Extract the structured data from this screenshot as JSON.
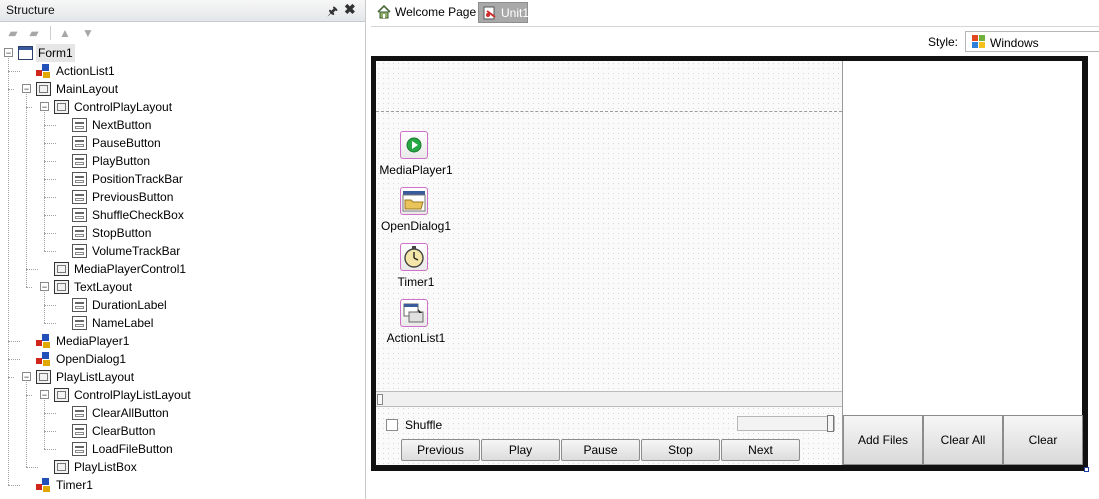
{
  "structure": {
    "title": "Structure",
    "pin_glyph": "🖈",
    "close_glyph": "✖",
    "toolbar": [
      {
        "icon": "folder-add-icon",
        "glyph": "▰"
      },
      {
        "icon": "folder-remove-icon",
        "glyph": "▰"
      },
      {
        "icon": "arrow-up-icon",
        "glyph": "▲"
      },
      {
        "icon": "arrow-down-icon",
        "glyph": "▼"
      }
    ],
    "tree": [
      {
        "label": "Form1",
        "icon": "form",
        "level": 0,
        "expander": "−",
        "selected": true
      },
      {
        "label": "ActionList1",
        "icon": "comp",
        "level": 1
      },
      {
        "label": "MainLayout",
        "icon": "layout",
        "level": 1,
        "expander": "−"
      },
      {
        "label": "ControlPlayLayout",
        "icon": "layout",
        "level": 2,
        "expander": "−"
      },
      {
        "label": "NextButton",
        "icon": "ctrl",
        "level": 3
      },
      {
        "label": "PauseButton",
        "icon": "ctrl",
        "level": 3
      },
      {
        "label": "PlayButton",
        "icon": "ctrl",
        "level": 3
      },
      {
        "label": "PositionTrackBar",
        "icon": "ctrl",
        "level": 3
      },
      {
        "label": "PreviousButton",
        "icon": "ctrl",
        "level": 3
      },
      {
        "label": "ShuffleCheckBox",
        "icon": "ctrl",
        "level": 3
      },
      {
        "label": "StopButton",
        "icon": "ctrl",
        "level": 3
      },
      {
        "label": "VolumeTrackBar",
        "icon": "ctrl",
        "level": 3
      },
      {
        "label": "MediaPlayerControl1",
        "icon": "layout",
        "level": 2
      },
      {
        "label": "TextLayout",
        "icon": "layout",
        "level": 2,
        "expander": "−"
      },
      {
        "label": "DurationLabel",
        "icon": "ctrl",
        "level": 3
      },
      {
        "label": "NameLabel",
        "icon": "ctrl",
        "level": 3
      },
      {
        "label": "MediaPlayer1",
        "icon": "comp",
        "level": 1
      },
      {
        "label": "OpenDialog1",
        "icon": "comp",
        "level": 1
      },
      {
        "label": "PlayListLayout",
        "icon": "layout",
        "level": 1,
        "expander": "−"
      },
      {
        "label": "ControlPlayListLayout",
        "icon": "layout",
        "level": 2,
        "expander": "−"
      },
      {
        "label": "ClearAllButton",
        "icon": "ctrl",
        "level": 3
      },
      {
        "label": "ClearButton",
        "icon": "ctrl",
        "level": 3
      },
      {
        "label": "LoadFileButton",
        "icon": "ctrl",
        "level": 3
      },
      {
        "label": "PlayListBox",
        "icon": "layout",
        "level": 2
      },
      {
        "label": "Timer1",
        "icon": "comp",
        "level": 1
      }
    ]
  },
  "tabs": [
    {
      "label": "Welcome Page",
      "icon": "home-icon",
      "active": false
    },
    {
      "label": "Unit1",
      "icon": "unit-file-icon",
      "active": true
    }
  ],
  "stylebar": {
    "label": "Style:",
    "value": "Windows",
    "icon": "windows-flag-icon"
  },
  "designer": {
    "components": [
      {
        "label": "MediaPlayer1",
        "icon": "media-player-icon"
      },
      {
        "label": "OpenDialog1",
        "icon": "open-dialog-icon"
      },
      {
        "label": "Timer1",
        "icon": "timer-icon"
      },
      {
        "label": "ActionList1",
        "icon": "action-list-icon"
      }
    ],
    "shuffle_label": "Shuffle",
    "shuffle_checked": false,
    "play_buttons": [
      "Previous",
      "Play",
      "Pause",
      "Stop",
      "Next"
    ],
    "playlist_buttons": [
      "Add Files",
      "Clear All",
      "Clear"
    ]
  },
  "colors": {
    "media_icon": "#27a844",
    "clock_face": "#f4e6a8",
    "component_border": "#d070c8"
  }
}
